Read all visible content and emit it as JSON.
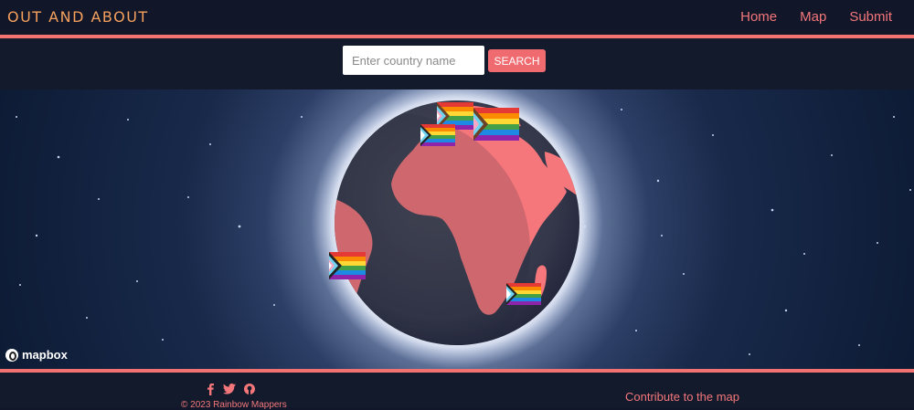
{
  "brand": {
    "title": "OUT AND ABOUT"
  },
  "nav": {
    "items": [
      {
        "label": "Home"
      },
      {
        "label": "Map"
      },
      {
        "label": "Submit"
      }
    ]
  },
  "search": {
    "placeholder": "Enter country name",
    "button_label": "SEARCH"
  },
  "map": {
    "attribution": "mapbox",
    "land_color": "#f5767b",
    "globe_color": "#3b3e4b",
    "flag_icon": "pride-flag-icon"
  },
  "footer": {
    "icons": [
      "facebook-icon",
      "twitter-icon",
      "github-icon"
    ],
    "copyright": "© 2023 Rainbow Mappers",
    "contribute_link": "Contribute to the map"
  },
  "colors": {
    "accent": "#f27171",
    "brand": "#f5a15d",
    "background": "#111629"
  }
}
